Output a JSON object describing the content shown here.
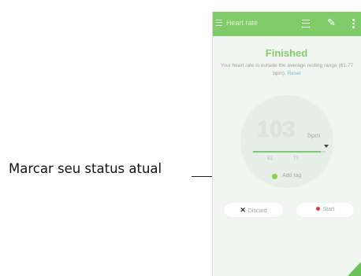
{
  "callout": {
    "label": "Marcar seu status atual"
  },
  "app": {
    "title": "Heart rate",
    "icons": [
      "menu-icon",
      "list-icon",
      "share-icon",
      "more-icon"
    ],
    "status_title": "Finished",
    "status_desc": "Your heart rate is outside the average resting range (61-77 bpm).",
    "status_link": "Reset",
    "bpm_value": "103",
    "bpm_unit": "bpm",
    "range_low": "61",
    "range_high": "77",
    "range_fill_fraction": 0.93,
    "tag_label": "Add tag",
    "discard_label": "Discard",
    "start_label": "Start",
    "accent_color": "#80cc68"
  }
}
